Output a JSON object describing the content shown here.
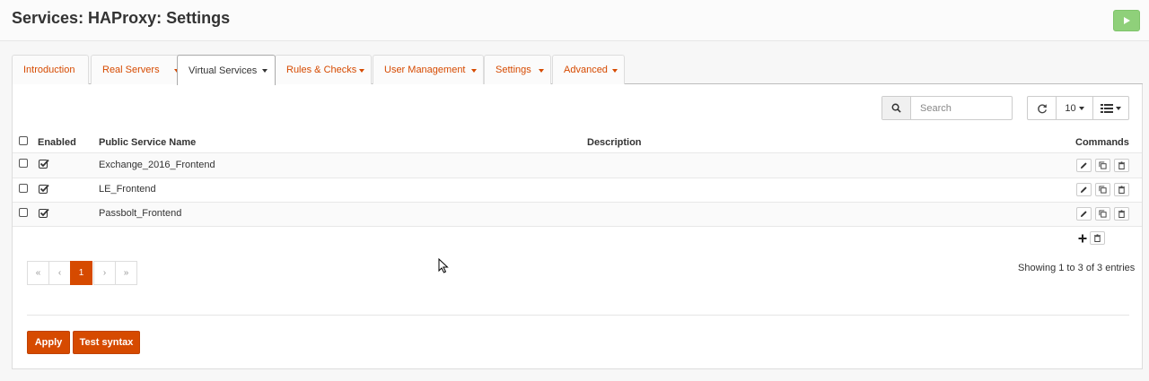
{
  "page": {
    "title": "Services: HAProxy: Settings"
  },
  "tabs": [
    {
      "label": "Introduction",
      "active": false,
      "has_menu": false
    },
    {
      "label": "Real Servers",
      "active": false,
      "has_menu": true
    },
    {
      "label": "Virtual Services",
      "active": true,
      "has_menu": true
    },
    {
      "label": "Rules & Checks",
      "active": false,
      "has_menu": true
    },
    {
      "label": "User Management",
      "active": false,
      "has_menu": true
    },
    {
      "label": "Settings",
      "active": false,
      "has_menu": true
    },
    {
      "label": "Advanced",
      "active": false,
      "has_menu": true
    }
  ],
  "toolbar": {
    "search_placeholder": "Search",
    "search_value": "",
    "page_size": "10",
    "icons": [
      "search-icon",
      "refresh-icon",
      "column-list-icon"
    ]
  },
  "table": {
    "headers": {
      "enabled": "Enabled",
      "name": "Public Service Name",
      "description": "Description",
      "commands": "Commands"
    },
    "rows": [
      {
        "enabled": true,
        "name": "Exchange_2016_Frontend",
        "description": ""
      },
      {
        "enabled": true,
        "name": "LE_Frontend",
        "description": ""
      },
      {
        "enabled": true,
        "name": "Passbolt_Frontend",
        "description": ""
      }
    ]
  },
  "pagination": {
    "first": "«",
    "prev": "‹",
    "current": "1",
    "next": "›",
    "last": "»",
    "summary": "Showing 1 to 3 of 3 entries"
  },
  "actions": {
    "apply": "Apply",
    "test_syntax": "Test syntax"
  },
  "colors": {
    "accent": "#d64a00",
    "run_button": "#8fd07a"
  }
}
